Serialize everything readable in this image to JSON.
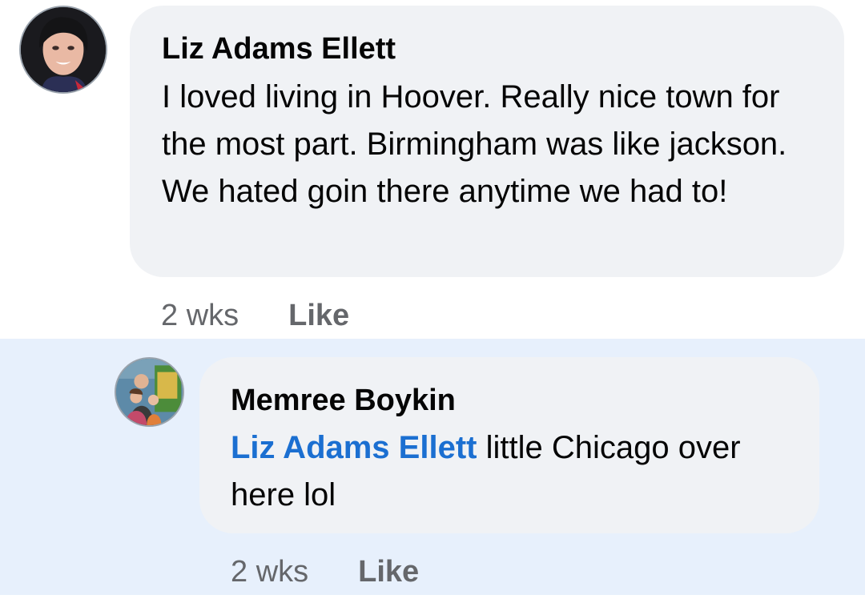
{
  "comments": [
    {
      "author": "Liz Adams Ellett",
      "text": "I loved living in Hoover. Really nice town for the most part. Birmingham was like jackson. We hated goin there anytime we had to!",
      "time": "2 wks",
      "like_label": "Like"
    }
  ],
  "reply": {
    "author": "Memree Boykin",
    "mention": "Liz Adams Ellett",
    "text": " little Chicago over here lol",
    "time": "2 wks",
    "like_label": "Like"
  },
  "colors": {
    "bubble": "#f0f2f5",
    "highlight": "#e7f0fc",
    "mention": "#1b6fd1",
    "meta": "#65676b"
  }
}
